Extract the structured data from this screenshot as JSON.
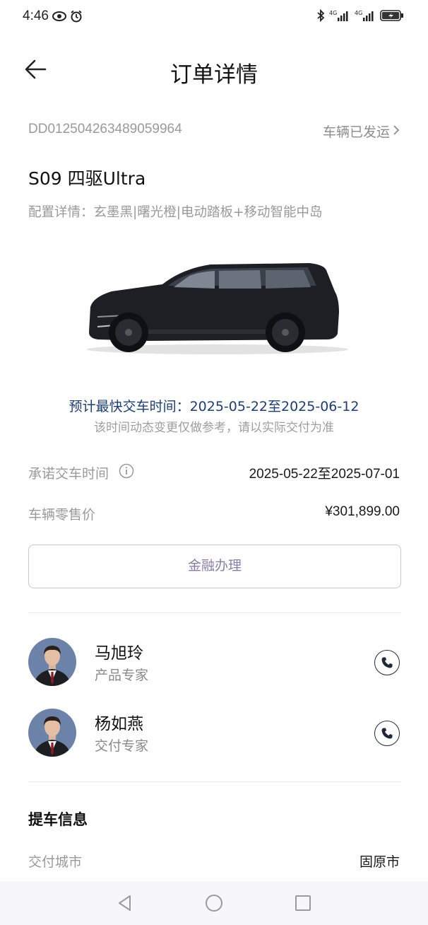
{
  "status_bar": {
    "time": "4:46"
  },
  "header": {
    "title": "订单详情"
  },
  "order": {
    "number": "DD012504263489059964",
    "status": "车辆已发运"
  },
  "vehicle": {
    "model": "S09 四驱Ultra",
    "config": "配置详情：玄墨黑|曙光橙|电动踏板+移动智能中岛"
  },
  "delivery": {
    "estimate": "预计最快交车时间：2025-05-22至2025-06-12",
    "note": "该时间动态变更仅做参考，请以实际交付为准",
    "promised_label": "承诺交车时间",
    "promised_value": "2025-05-22至2025-07-01",
    "price_label": "车辆零售价",
    "price_value": "¥301,899.00"
  },
  "finance": {
    "button_label": "金融办理"
  },
  "contacts": [
    {
      "name": "马旭玲",
      "role": "产品专家"
    },
    {
      "name": "杨如燕",
      "role": "交付专家"
    }
  ],
  "pickup": {
    "section_title": "提车信息",
    "city_label": "交付城市",
    "city_value": "固原市"
  },
  "colors": {
    "accent_text": "#1d3e72",
    "finance_text": "#8a7ea8"
  }
}
